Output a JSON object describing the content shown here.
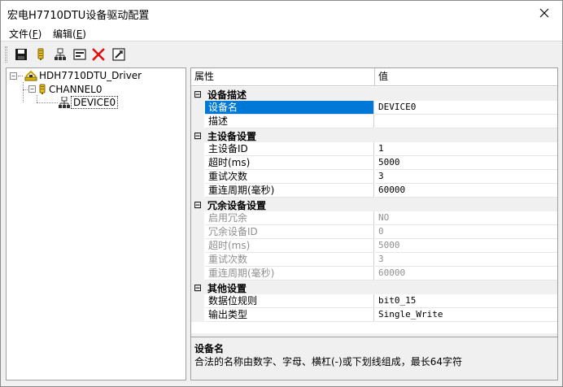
{
  "window": {
    "title": "宏电H7710DTU设备驱动配置"
  },
  "menu": [
    {
      "label": "文件",
      "key": "F"
    },
    {
      "label": "编辑",
      "key": "E"
    }
  ],
  "toolbar": {
    "buttons": [
      {
        "icon": "save-icon"
      },
      {
        "icon": "add-channel-icon"
      },
      {
        "icon": "add-device-icon"
      },
      {
        "icon": "card-icon"
      },
      {
        "icon": "delete-icon"
      },
      {
        "icon": "properties-icon"
      }
    ]
  },
  "tree": {
    "root": "HDH7710DTU_Driver",
    "channel": "CHANNEL0",
    "device": "DEVICE0"
  },
  "grid": {
    "header": {
      "name": "属性",
      "value": "值"
    },
    "categories": [
      {
        "label": "设备描述",
        "rows": [
          {
            "name": "设备名",
            "value": "DEVICE0",
            "selected": true
          },
          {
            "name": "描述",
            "value": ""
          }
        ]
      },
      {
        "label": "主设备设置",
        "rows": [
          {
            "name": "主设备ID",
            "value": "1"
          },
          {
            "name": "超时(ms)",
            "value": "5000"
          },
          {
            "name": "重试次数",
            "value": "3"
          },
          {
            "name": "重连周期(毫秒)",
            "value": "60000"
          }
        ]
      },
      {
        "label": "冗余设备设置",
        "rows": [
          {
            "name": "启用冗余",
            "value": "NO",
            "disabled": true
          },
          {
            "name": "冗余设备ID",
            "value": "0",
            "disabled": true
          },
          {
            "name": "超时(ms)",
            "value": "5000",
            "disabled": true
          },
          {
            "name": "重试次数",
            "value": "3",
            "disabled": true
          },
          {
            "name": "重连周期(毫秒)",
            "value": "60000",
            "disabled": true
          }
        ]
      },
      {
        "label": "其他设置",
        "rows": [
          {
            "name": "数据位规则",
            "value": "bit0_15"
          },
          {
            "name": "输出类型",
            "value": "Single_Write"
          }
        ]
      }
    ]
  },
  "help": {
    "title": "设备名",
    "description": "合法的名称由数字、字母、横杠(-)或下划线组成，最长64字符"
  }
}
